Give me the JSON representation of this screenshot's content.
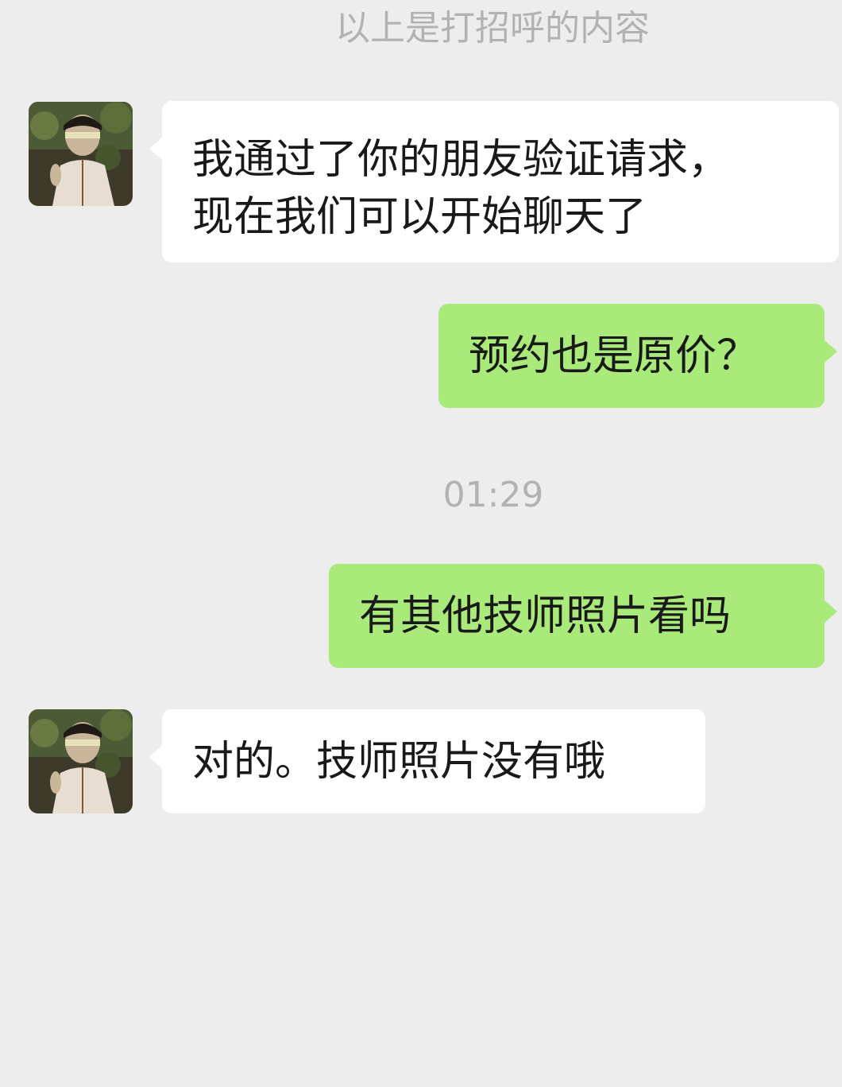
{
  "chat": {
    "system_notice": "以上是打招呼的内容",
    "timestamp": "01:29",
    "messages": [
      {
        "direction": "incoming",
        "lines": [
          "我通过了你的朋友验证请求，",
          "现在我们可以开始聊天了"
        ]
      },
      {
        "direction": "outgoing",
        "lines": [
          "预约也是原价？"
        ]
      },
      {
        "direction": "outgoing",
        "lines": [
          "有其他技师照片看吗"
        ]
      },
      {
        "direction": "incoming",
        "lines": [
          "对的。技师照片没有哦"
        ]
      }
    ]
  },
  "contact": {
    "avatar_icon": "contact-avatar-photo"
  },
  "colors": {
    "background": "#ededed",
    "incoming_bubble": "#ffffff",
    "outgoing_bubble": "#a9ea7a",
    "system_text": "#b2b2b2",
    "message_text": "#191919"
  }
}
